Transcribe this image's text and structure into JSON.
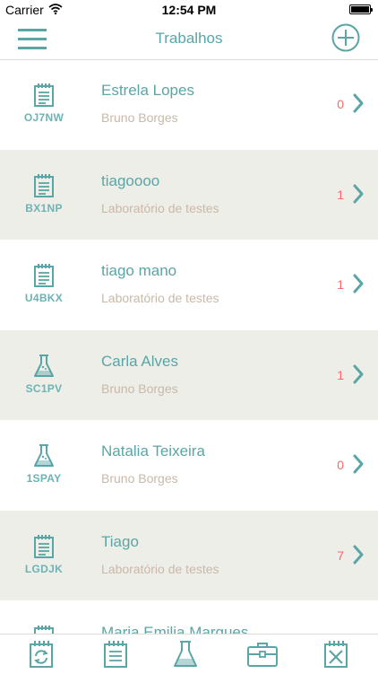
{
  "status_bar": {
    "carrier": "Carrier",
    "time": "12:54 PM"
  },
  "nav": {
    "title": "Trabalhos"
  },
  "items": [
    {
      "code": "OJ7NW",
      "name": "Estrela Lopes",
      "subtitle": "Bruno Borges",
      "count": "0",
      "icon": "notepad-icon"
    },
    {
      "code": "BX1NP",
      "name": "tiagoooo",
      "subtitle": "Laboratório de testes",
      "count": "1",
      "icon": "notepad-icon"
    },
    {
      "code": "U4BKX",
      "name": "tiago mano",
      "subtitle": "Laboratório de testes",
      "count": "1",
      "icon": "notepad-icon"
    },
    {
      "code": "SC1PV",
      "name": "Carla Alves",
      "subtitle": "Bruno Borges",
      "count": "1",
      "icon": "flask-icon"
    },
    {
      "code": "1SPAY",
      "name": "Natalia Teixeira",
      "subtitle": "Bruno Borges",
      "count": "0",
      "icon": "flask-icon"
    },
    {
      "code": "LGDJK",
      "name": "Tiago",
      "subtitle": "Laboratório de testes",
      "count": "7",
      "icon": "notepad-icon"
    },
    {
      "code": "",
      "name": "Maria Emilia Marques",
      "subtitle": "",
      "count": "",
      "icon": "notepad-icon"
    }
  ],
  "tabbar": {
    "tabs": [
      "refresh-notepad-icon",
      "notepad-icon",
      "flask-icon",
      "briefcase-icon",
      "cancelled-notepad-icon"
    ]
  },
  "colors": {
    "accent": "#5aa5a5",
    "subtitle": "#c9b8a9",
    "count": "#f26b6b",
    "alt_row": "#eeeee8"
  }
}
